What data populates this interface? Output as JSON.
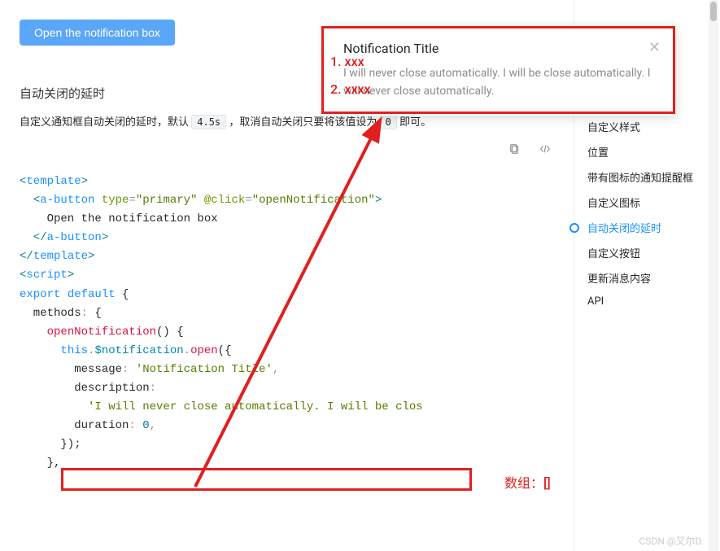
{
  "button": {
    "label": "Open the notification box"
  },
  "section": {
    "title": "自动关闭的延时",
    "desc1": "自定义通知框自动关闭的延时，默认",
    "code1": "4.5s",
    "desc2": "，取消自动关闭只要将该值设为",
    "code2": "0",
    "desc3": "即可。"
  },
  "notification": {
    "title": "Notification Title",
    "body": "I will never close automatically. I will be close automatically. I will never close automatically.",
    "close": "✕"
  },
  "sidebar": {
    "items": [
      {
        "label": "自定义样式",
        "active": false
      },
      {
        "label": "位置",
        "active": false
      },
      {
        "label": "带有图标的通知提醒框",
        "active": false
      },
      {
        "label": "自定义图标",
        "active": false
      },
      {
        "label": "自动关闭的延时",
        "active": true
      },
      {
        "label": "自定义按钮",
        "active": false
      },
      {
        "label": "更新消息内容",
        "active": false
      },
      {
        "label": "API",
        "active": false
      }
    ]
  },
  "code": {
    "l1a": "<",
    "l1b": "template",
    "l1c": ">",
    "l2a": "  <",
    "l2b": "a-button",
    "l2c": " ",
    "l2d": "type",
    "l2e": "=",
    "l2f": "\"primary\"",
    "l2g": " ",
    "l2h": "@click",
    "l2i": "=",
    "l2j": "\"openNotification\"",
    "l2k": ">",
    "l3": "    Open the notification box",
    "l4a": "  </",
    "l4b": "a-button",
    "l4c": ">",
    "l5a": "</",
    "l5b": "template",
    "l5c": ">",
    "l6a": "<",
    "l6b": "script",
    "l6c": ">",
    "l7a": "export",
    "l7b": " ",
    "l7c": "default",
    "l7d": " {",
    "l8a": "  methods",
    "l8b": ":",
    "l8c": " {",
    "l9a": "    ",
    "l9b": "openNotification",
    "l9c": "() {",
    "l10a": "      ",
    "l10b": "this",
    "l10c": ".",
    "l10d": "$notification",
    "l10e": ".",
    "l10f": "open",
    "l10g": "({",
    "l11a": "        message",
    "l11b": ":",
    "l11c": " ",
    "l11d": "'Notification Title'",
    "l11e": ",",
    "l12a": "        description",
    "l12b": ":",
    "l13a": "          ",
    "l13b": "'I will never close automatically. I will be clos",
    "l14a": "        duration",
    "l14b": ":",
    "l14c": " ",
    "l14d": "0",
    "l14e": ",",
    "l15": "      });",
    "l16": "    },"
  },
  "annotations": {
    "a1": "1. xxx",
    "a2": "2. xxxx",
    "a3": "数组：[]"
  },
  "watermark": "CSDN @又尔D."
}
